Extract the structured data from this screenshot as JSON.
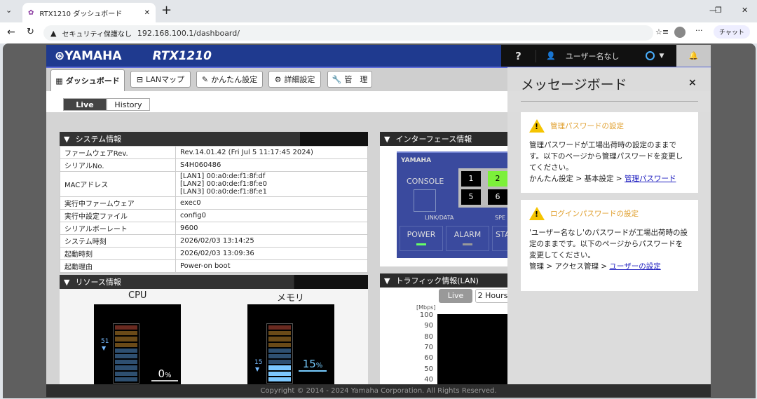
{
  "browser": {
    "tab_title": "RTX1210 ダッシュボード",
    "security": "セキュリティ保護なし",
    "url": "192.168.100.1/dashboard/",
    "chat": "チャット"
  },
  "header": {
    "brand": "YAMAHA",
    "model": "RTX1210",
    "help": "?",
    "user": "ユーザー名なし"
  },
  "nav": {
    "items": [
      {
        "label": "ダッシュボード"
      },
      {
        "label": "LANマップ"
      },
      {
        "label": "かんたん設定"
      },
      {
        "label": "詳細設定"
      },
      {
        "label": "管　理"
      }
    ]
  },
  "view": {
    "live": "Live",
    "history": "History"
  },
  "system": {
    "title": "システム情報",
    "rows": [
      {
        "k": "ファームウェアRev.",
        "v": "Rev.14.01.42 (Fri Jul 5 11:17:45 2024)"
      },
      {
        "k": "シリアルNo.",
        "v": "S4H060486"
      },
      {
        "k": "MACアドレス",
        "v": "[LAN1] 00:a0:de:f1:8f:df\n[LAN2] 00:a0:de:f1:8f:e0\n[LAN3] 00:a0:de:f1:8f:e1"
      },
      {
        "k": "実行中ファームウェア",
        "v": "exec0"
      },
      {
        "k": "実行中設定ファイル",
        "v": "config0"
      },
      {
        "k": "シリアルボーレート",
        "v": "9600"
      },
      {
        "k": "システム時刻",
        "v": "2026/02/03 13:14:25"
      },
      {
        "k": "起動時刻",
        "v": "2026/02/03 13:09:36"
      },
      {
        "k": "起動理由",
        "v": "Power-on boot"
      }
    ]
  },
  "interface": {
    "title": "インターフェース情報",
    "brand": "YAMAHA",
    "console": "CONSOLE",
    "ports": [
      "1",
      "2",
      "5",
      "6"
    ],
    "link": "LINK/DATA",
    "speed": "SPE",
    "power": "POWER",
    "alarm": "ALARM",
    "status": "STA"
  },
  "resource": {
    "title": "リソース情報",
    "cpu": {
      "label": "CPU",
      "peak": "51",
      "value": "0",
      "unit": "%"
    },
    "mem": {
      "label": "メモリ",
      "peak": "15",
      "value": "15",
      "unit": "%"
    }
  },
  "traffic": {
    "title": "トラフィック情報(LAN)",
    "live": "Live",
    "hours": "2 Hours",
    "unit": "[Mbps]",
    "ticks": [
      "100",
      "90",
      "80",
      "70",
      "60",
      "50",
      "40"
    ]
  },
  "messages": {
    "title": "メッセージボード",
    "close": "×",
    "cards": [
      {
        "title": "管理パスワードの設定",
        "body": "管理パスワードが工場出荷時の設定のままです。以下のページから管理パスワードを変更してください。",
        "path": "かんたん設定 > 基本設定 > ",
        "link": "管理パスワード"
      },
      {
        "title": "ログインパスワードの設定",
        "body": "'ユーザー名なし'のパスワードが工場出荷時の設定のままです。以下のページからパスワードを変更してください。",
        "path": "管理 > アクセス管理 > ",
        "link": "ユーザーの設定"
      }
    ]
  },
  "footer": "Copyright © 2014 - 2024 Yamaha Corporation. All Rights Reserved."
}
